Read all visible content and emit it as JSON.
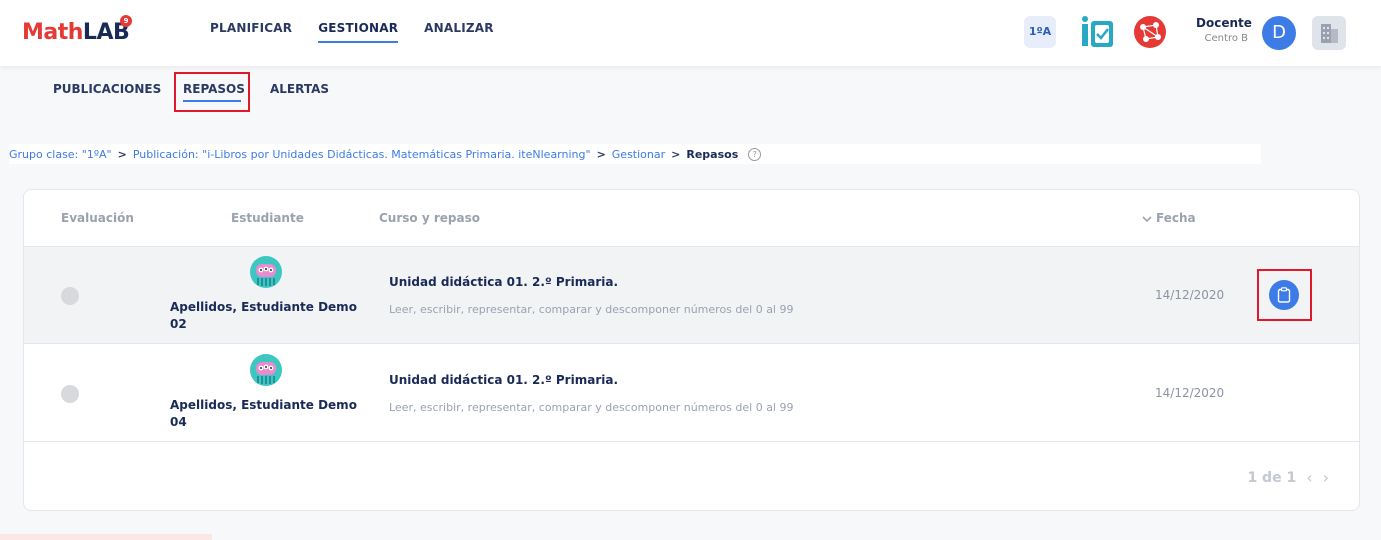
{
  "header": {
    "logo_part1": "Math",
    "logo_part2": "LAB",
    "logo_badge": "9",
    "nav": [
      {
        "label": "PLANIFICAR",
        "active": false
      },
      {
        "label": "GESTIONAR",
        "active": true
      },
      {
        "label": "ANALIZAR",
        "active": false
      }
    ],
    "group_badge": "1ºA",
    "user_role": "Docente",
    "user_center": "Centro B",
    "avatar_letter": "D"
  },
  "subnav": {
    "items": [
      {
        "label": "PUBLICACIONES",
        "active": false
      },
      {
        "label": "REPASOS",
        "active": true
      },
      {
        "label": "ALERTAS",
        "active": false
      }
    ]
  },
  "breadcrumb": {
    "items": [
      "Grupo clase: \"1ºA\"",
      "Publicación: \"i-Libros por Unidades Didácticas. Matemáticas Primaria. iteNlearning\"",
      "Gestionar"
    ],
    "separator": ">",
    "current": "Repasos"
  },
  "table": {
    "headers": {
      "evaluacion": "Evaluación",
      "estudiante": "Estudiante",
      "curso": "Curso y repaso",
      "fecha": "Fecha",
      "sort_icon": "chevron-down-icon"
    },
    "rows": [
      {
        "student": "Apellidos, Estudiante Demo 02",
        "course_title": "Unidad didáctica 01. 2.º Primaria.",
        "course_desc": "Leer, escribir, representar, comparar y descomponer números del 0 al 99",
        "date": "14/12/2020",
        "action_icon": "clipboard-icon"
      },
      {
        "student": "Apellidos, Estudiante Demo 04",
        "course_title": "Unidad didáctica 01. 2.º Primaria.",
        "course_desc": "Leer, escribir, representar, comparar y descomponer números del 0 al 99",
        "date": "14/12/2020"
      }
    ]
  },
  "pagination": {
    "label": "1 de 1",
    "prev": "‹",
    "next": "›"
  },
  "colors": {
    "accent": "#3d7be6",
    "brand_red": "#e53935",
    "navy": "#1a2a57",
    "highlight_box": "#e0182c"
  }
}
